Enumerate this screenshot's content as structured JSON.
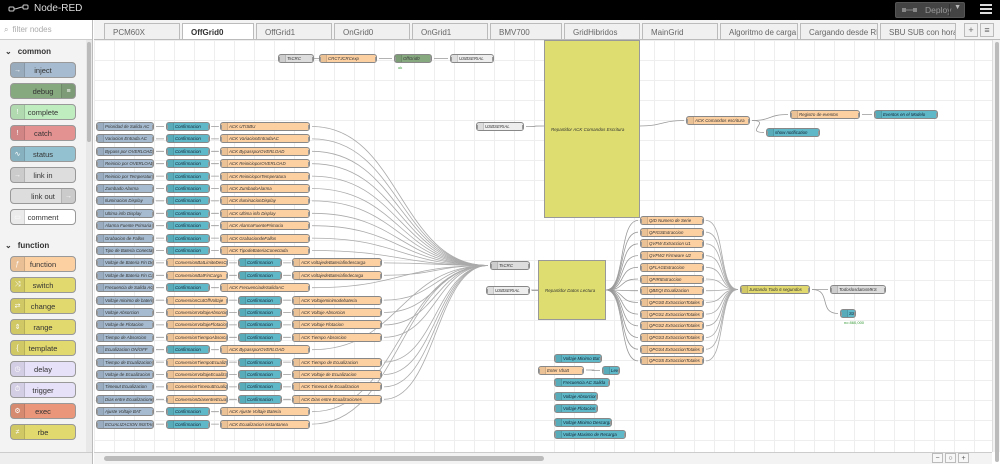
{
  "header": {
    "title": "Node-RED",
    "deploy_label": "Deploy"
  },
  "palette": {
    "filter_placeholder": "filter nodes",
    "sections": [
      {
        "label": "common",
        "nodes": [
          {
            "label": "inject",
            "color": "#a6bbcf"
          },
          {
            "label": "debug",
            "color": "#87a980"
          },
          {
            "label": "complete",
            "color": "#c0edc0"
          },
          {
            "label": "catch",
            "color": "#e49191"
          },
          {
            "label": "status",
            "color": "#94c1d0"
          },
          {
            "label": "link in",
            "color": "#dddddd"
          },
          {
            "label": "link out",
            "color": "#dddddd"
          },
          {
            "label": "comment",
            "color": "#ffffff"
          }
        ]
      },
      {
        "label": "function",
        "nodes": [
          {
            "label": "function",
            "color": "#fdd0a2"
          },
          {
            "label": "switch",
            "color": "#e2d96e"
          },
          {
            "label": "change",
            "color": "#e2d96e"
          },
          {
            "label": "range",
            "color": "#e2d96e"
          },
          {
            "label": "template",
            "color": "#e2d96e"
          },
          {
            "label": "delay",
            "color": "#e6e0f8"
          },
          {
            "label": "trigger",
            "color": "#e6e0f8"
          },
          {
            "label": "exec",
            "color": "#e9967a"
          },
          {
            "label": "rbe",
            "color": "#e2d96e"
          }
        ]
      }
    ]
  },
  "tabs": [
    "PCM60X",
    "OffGrid0",
    "OffGrid1",
    "OnGrid0",
    "OnGrid1",
    "BMV700",
    "GridHibridos",
    "MainGrid",
    "Algoritmo de carga",
    "Cargando desde RE",
    "SBU SUB con horari"
  ],
  "active_tab": "OffGrid0",
  "flow": {
    "top_row": [
      "TsCRC",
      "CRCTJCRCexp",
      "OffGrid0",
      "USBSERIAL"
    ],
    "top_status": "ok",
    "commands": [
      [
        "Prioridad de Salida AC",
        "Confirmacion",
        "ACK UTISBU"
      ],
      [
        "Variacion Entrada AC",
        "Confirmacion",
        "ACK VariacionEntradaAC"
      ],
      [
        "Bypass por OVERLOAD",
        "Confirmacion",
        "ACK BypassporOVERLOAD"
      ],
      [
        "Reinicio por OVERLOAD",
        "Confirmacion",
        "ACK ReinicioporOVERLOAD"
      ],
      [
        "Reinicio por Temperatura",
        "Confirmacion",
        "ACK ReinicioporTemperatura"
      ],
      [
        "Zumbado Alarma",
        "Confirmacion",
        "ACK ZumbadoAlarma"
      ],
      [
        "Iluminacion Display",
        "Confirmacion",
        "ACK IluminacionDisplay"
      ],
      [
        "Ultima info Display",
        "Confirmacion",
        "ACK Ultima info Display"
      ],
      [
        "Alarma Fuente Primaria",
        "Confirmacion",
        "ACK AlarmaFuentePrimaria"
      ],
      [
        "Grabacion de Fallos",
        "Confirmacion",
        "ACK GrabaciondeFallos"
      ],
      [
        "Tipo de Bateria Conectada",
        "Confirmacion",
        "ACK TipodeBateriaConectada"
      ],
      [
        "Voltaje de Bateria Fin Descarga",
        "ConversionBatLimiteDesCarga",
        "Confirmacion",
        "ACK voltajedeBateriafindescarga"
      ],
      [
        "Voltaje de Bateria Fin Carga",
        "ConversionBatFinCarga",
        "Confirmacion",
        "ACK voltajedeBateriafindecarga"
      ],
      [
        "Frecuencia de Salida AC",
        "Confirmacion",
        "ACK FrecuenciadeSalidaAC"
      ],
      [
        "Voltaje minimo de bateria",
        "ConversionCutOffVoltaje",
        "Confirmacion",
        "ACK Voltajeminimodebateria"
      ],
      [
        "Voltaje Absorcion",
        "ConversionVoltajeAbsorcion",
        "Confirmacion",
        "ACK Voltaje Absorcion"
      ],
      [
        "Voltaje de Flotacion",
        "ConversionVoltajeFlotacion",
        "Confirmacion",
        "ACK Voltaje Flotacion"
      ],
      [
        "Tiempo de Absorcion",
        "ConversionTiempoAbsorcion",
        "Confirmacion",
        "ACK Tiempo Absorcion"
      ],
      [
        "Ecualizacion ON/OFF",
        "Confirmacion",
        "ACK BypassporOVERLOAD"
      ],
      [
        "Tiempo de Ecualizacion",
        "ConversionTiempoEcualizacion",
        "Confirmacion",
        "ACK Tiempo de Ecualizacion"
      ],
      [
        "Voltaje de Ecualizacion",
        "ConversionVoltajeEcualizacion",
        "Confirmacion",
        "ACK Voltaje de Ecualizacion"
      ],
      [
        "Timeout Ecualizacion",
        "ConversionTimeoutEcualizacion",
        "Confirmacion",
        "ACK Timeout de Ecualizacion"
      ],
      [
        "Dias entre Ecualizaciones",
        "ConversionDiasentreEcualizacion",
        "Confirmacion",
        "ACK Dias entre Ecualizaciones"
      ],
      [
        "Ajuste Voltaje BAT",
        "Confirmacion",
        "ACK Ajuste Voltaje Bateria"
      ],
      [
        "ECUALIZACION INSTANTANEA",
        "Confirmacion",
        "ACK Ecualizacion instantanea"
      ]
    ],
    "repartidor_escritura": "Repartidor ACK Comandos Escritura",
    "repartidor_lectura": "Repartidor Datos Lectura",
    "usbserial": "USBSERIAL",
    "tscrc": "TsCRC",
    "ack_escritura": "ACK Comandos escritura",
    "registro": "Registro de eventos",
    "eventos_modelo": "Eventos en el Modelo",
    "show_notif": "show notification",
    "queries": [
      "QID Numero de Serie",
      "QPIGSExtraccion",
      "QVFW Extraccion U1",
      "QVFW2 Firmware U2",
      "QFLAGExtraccion",
      "QPIRIExtraccion",
      "QBEQI Ecualizacion",
      "QPGS0 ExtraccionTotales",
      "QPGS1 ExtraccionTotales",
      "QPGS2 ExtraccionTotales",
      "QPGS3 ExtraccionTotales",
      "QPGS4 ExtraccionTotales",
      "QPGS5 ExtraccionTotales"
    ],
    "junta": "Juntando Todo 6 segundos",
    "todos_datos": "TodoslosdatosMKS",
    "ssd_label": "SSd",
    "ssd_status": "no 860,000",
    "ui_nodes": [
      "Voltaje Minimo Bat",
      "Enter Vbatt",
      "Level",
      "Frecuencia AC Salida",
      "Voltaje Absorcion",
      "Voltaje Flotacion",
      "Voltaje Minimo Descarga",
      "Voltaje Maximo de Recarga"
    ]
  }
}
